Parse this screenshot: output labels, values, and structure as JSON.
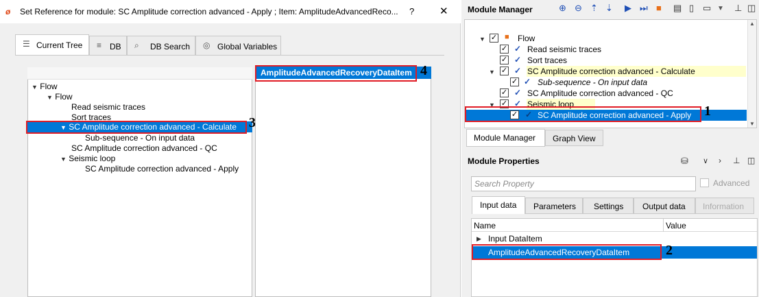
{
  "dialog": {
    "title": "Set Reference for module: SC Amplitude correction advanced - Apply ; Item: AmplitudeAdvancedReco...",
    "logo_text": "ø",
    "help": "?",
    "close": "✕",
    "tabs": [
      {
        "label": "Current Tree",
        "icon": "tree-icon"
      },
      {
        "label": "DB",
        "icon": "database-icon"
      },
      {
        "label": "DB Search",
        "icon": "search-icon"
      },
      {
        "label": "Global Variables",
        "icon": "globe-icon"
      }
    ],
    "tree": [
      {
        "label": "Flow"
      },
      {
        "label": "Flow"
      },
      {
        "label": "Read seismic traces"
      },
      {
        "label": "Sort traces"
      },
      {
        "label": "SC Amplitude correction advanced - Calculate"
      },
      {
        "label": "Sub-sequence - On input data"
      },
      {
        "label": "SC Amplitude correction advanced - QC"
      },
      {
        "label": "Seismic loop"
      },
      {
        "label": "SC Amplitude correction advanced - Apply"
      }
    ],
    "right_header": "AmplitudeAdvancedRecoveryDataItem"
  },
  "annotations": {
    "a1": "1",
    "a2": "2",
    "a3": "3",
    "a4": "4"
  },
  "module_manager": {
    "title": "Module Manager",
    "tree": [
      {
        "label": "Flow"
      },
      {
        "label": "Read seismic traces"
      },
      {
        "label": "Sort traces"
      },
      {
        "label": "SC Amplitude correction advanced - Calculate"
      },
      {
        "label": "Sub-sequence - On input data"
      },
      {
        "label": "SC Amplitude correction advanced - QC"
      },
      {
        "label": "Seismic loop"
      },
      {
        "label": "SC Amplitude correction advanced - Apply"
      }
    ],
    "bottom_tabs": [
      "Module Manager",
      "Graph View"
    ]
  },
  "module_properties": {
    "title": "Module Properties",
    "search_placeholder": "Search Property",
    "advanced_label": "Advanced",
    "tabs": [
      "Input data",
      "Parameters",
      "Settings",
      "Output data",
      "Information"
    ],
    "columns": [
      "Name",
      "Value"
    ],
    "rows": [
      {
        "name": "Input DataItem"
      },
      {
        "name": "AmplitudeAdvancedRecoveryDataItem"
      }
    ]
  },
  "colors": {
    "selection": "#0078d7",
    "highlight_box": "#e01b24",
    "accent_orange": "#e8701a"
  }
}
